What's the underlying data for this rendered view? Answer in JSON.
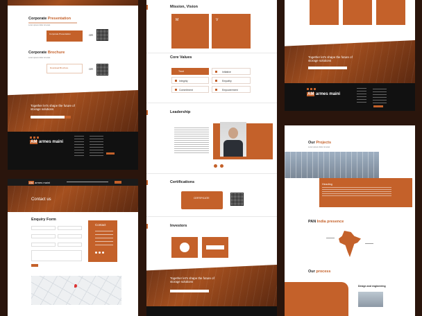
{
  "col1": {
    "corp_presentation": {
      "title_a": "Corporate ",
      "title_b": "Presentation"
    },
    "card1_label": "Corporate Presentation",
    "corp_brochure": {
      "title_a": "Corporate ",
      "title_b": "Brochure"
    },
    "card2_label": "Download Brochure",
    "cta": {
      "line1": "Together let's shape the future of",
      "line2": "storage solutions"
    },
    "brand": "armes maini"
  },
  "col1b": {
    "brand": "armes maini",
    "hero_title": "Contact us",
    "enquiry_title": "Enquiry Form",
    "contact_title": "Contact",
    "submit": "Submit"
  },
  "col2": {
    "mission_title": "Mission, Vision",
    "mission_card": "M",
    "vision_card": "V",
    "core_title": "Core Values",
    "values": [
      "Trust",
      "Initiative",
      "Integrity",
      "Empathy",
      "Commitment",
      "Empowerment"
    ],
    "leadership_title": "Leadership",
    "cert_title": "Certifications",
    "cert_badge": "CERTIFICATE",
    "investors_title": "Investors",
    "cta": {
      "line1": "Together let's shape the future of",
      "line2": "storage solutions"
    }
  },
  "col3": {
    "cta": {
      "line1": "Together let's shape the future of",
      "line2": "storage solutions"
    },
    "brand": "armes maini"
  },
  "col3b": {
    "projects": {
      "title_a": "Our ",
      "title_b": "Projects"
    },
    "project_name": "Heading",
    "pan": {
      "title_a": "PAN ",
      "title_b": "India presence"
    },
    "process": {
      "title_a": "Our ",
      "title_b": "process"
    },
    "design": "Design and engineering"
  },
  "colors": {
    "accent": "#c4612a",
    "dark": "#111111",
    "bg": "#2a150c"
  }
}
